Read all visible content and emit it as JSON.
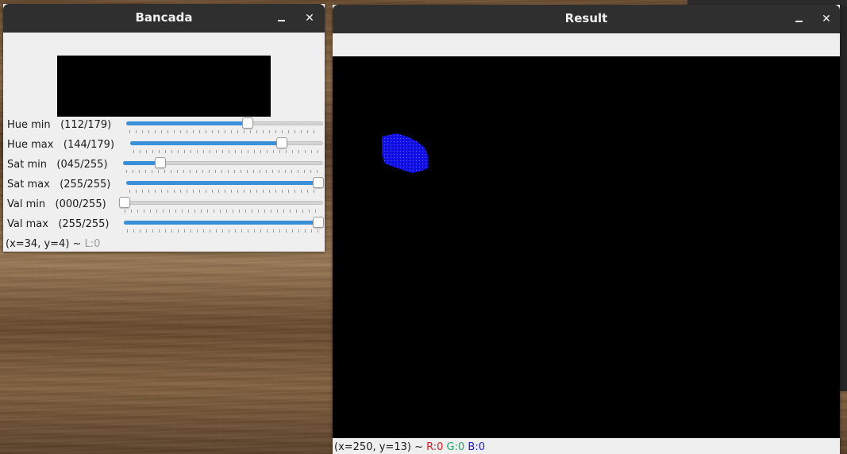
{
  "desktop": {
    "background": "wood"
  },
  "bancada": {
    "title": "Bancada",
    "minimize_icon": "minimize-icon",
    "close_label": "✕",
    "trackbars": [
      {
        "label": "Hue min",
        "value_text": "(112/179)",
        "value": 112,
        "max": 179
      },
      {
        "label": "Hue max",
        "value_text": "(144/179)",
        "value": 144,
        "max": 179
      },
      {
        "label": "Sat min",
        "value_text": "(045/255)",
        "value": 45,
        "max": 255
      },
      {
        "label": "Sat max",
        "value_text": "(255/255)",
        "value": 255,
        "max": 255
      },
      {
        "label": "Val min",
        "value_text": "(000/255)",
        "value": 0,
        "max": 255
      },
      {
        "label": "Val max",
        "value_text": "(255/255)",
        "value": 255,
        "max": 255
      }
    ],
    "status": {
      "coords": "(x=34, y=4) ~",
      "level": "L:0"
    }
  },
  "result": {
    "title": "Result",
    "minimize_icon": "minimize-icon",
    "close_label": "✕",
    "status": {
      "coords": "(x=250, y=13) ~",
      "r": "R:0",
      "g": "G:0",
      "b": "B:0"
    },
    "mask_color": "#1010f0"
  },
  "colors": {
    "accent": "#3a8fd9",
    "titlebar": "#2f2f2f",
    "window_bg": "#efefef"
  }
}
